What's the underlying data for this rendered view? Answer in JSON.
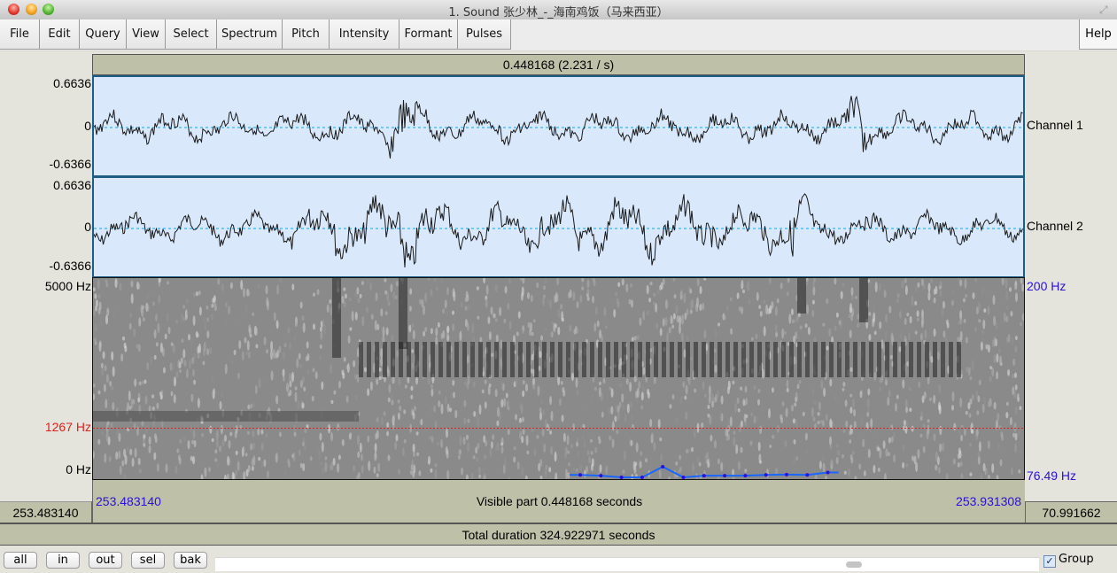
{
  "window": {
    "title": "1. Sound 张少林_-_海南鸡饭（马来西亚）",
    "traffic_lights": [
      "close",
      "minimize",
      "maximize"
    ]
  },
  "menu": {
    "items": [
      "File",
      "Edit",
      "Query",
      "View",
      "Select",
      "Spectrum",
      "Pitch",
      "Intensity",
      "Formant",
      "Pulses"
    ],
    "help": "Help"
  },
  "selection_bar": {
    "text": "0.448168 (2.231  / s)"
  },
  "channels": [
    {
      "name": "Channel 1",
      "max": "0.6636",
      "zero": "0",
      "min": "-0.6366"
    },
    {
      "name": "Channel 2",
      "max": "0.6636",
      "zero": "0",
      "min": "-0.6366"
    }
  ],
  "spectrogram": {
    "freq_max": "5000 Hz",
    "freq_cursor": "1267 Hz",
    "freq_min": "0 Hz",
    "pitch_max": "200 Hz",
    "pitch_min": "76.49 Hz",
    "cursor_color": "#e02020",
    "pitch_color": "#1a66ff",
    "pitch_track_hz": [
      78,
      77.5,
      76.5,
      76.5,
      83,
      76.5,
      77.5,
      77.5,
      77.5,
      78,
      78.2,
      78,
      79.5
    ]
  },
  "time": {
    "visible_start": "253.483140",
    "visible_end": "253.931308",
    "visible_part": "Visible part 0.448168 seconds",
    "left_value": "253.483140",
    "right_value": "70.991662",
    "total": "Total duration 324.922971 seconds"
  },
  "zoom_buttons": [
    "all",
    "in",
    "out",
    "sel",
    "bak"
  ],
  "group": {
    "label": "Group",
    "checked": true
  },
  "colors": {
    "time_blue": "#2a10d8",
    "wave_bg": "#d9e8fb",
    "panel": "#bfc0a8"
  }
}
